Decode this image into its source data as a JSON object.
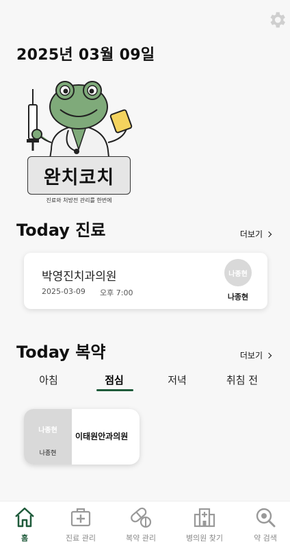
{
  "header": {
    "date": "2025년 03월 09일"
  },
  "logo": {
    "text": "완치코치",
    "tagline": "진료와 처방전 관리를 한번에"
  },
  "today_visit": {
    "title": "Today 진료",
    "more": "더보기",
    "card": {
      "clinic": "박영진치과의원",
      "date": "2025-03-09",
      "time": "오후 7:00",
      "avatar_text": "나종현",
      "patient": "나종현"
    }
  },
  "today_meds": {
    "title": "Today 복약",
    "more": "더보기",
    "tabs": [
      "아침",
      "점심",
      "저녁",
      "취침 전"
    ],
    "active_tab": "점심",
    "card": {
      "avatar_text": "나종현",
      "patient": "나종현",
      "clinic": "이태원안과의원"
    }
  },
  "nav": {
    "items": [
      {
        "label": "홈",
        "icon": "home-icon",
        "active": true
      },
      {
        "label": "진료 관리",
        "icon": "medical-kit-icon",
        "active": false
      },
      {
        "label": "복약 관리",
        "icon": "pill-icon",
        "active": false
      },
      {
        "label": "병의원 찾기",
        "icon": "hospital-icon",
        "active": false
      },
      {
        "label": "약 검색",
        "icon": "search-icon",
        "active": false
      }
    ]
  },
  "colors": {
    "accent": "#1e5a3a",
    "avatar_bg": "#d9d9d9",
    "background": "#f7f7f7"
  }
}
